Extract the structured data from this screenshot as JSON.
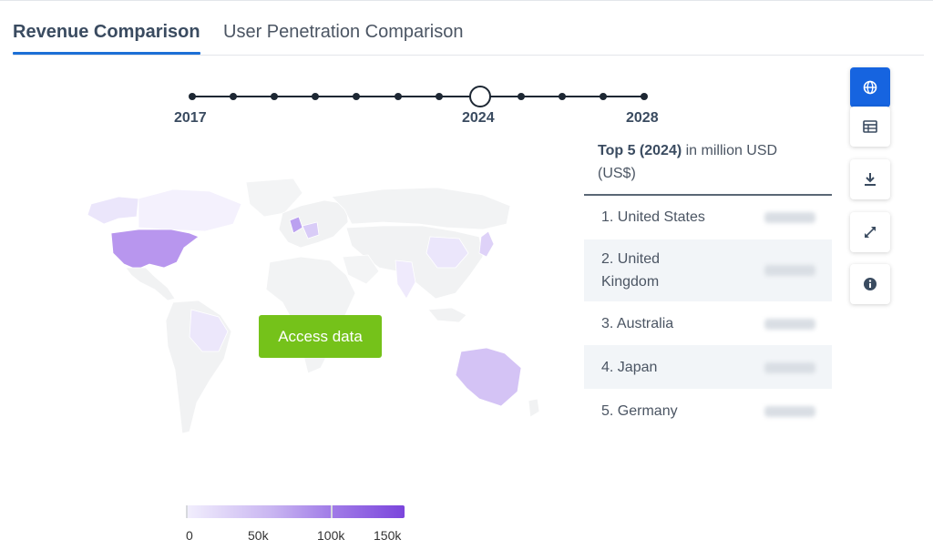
{
  "tabs": [
    {
      "label": "Revenue Comparison",
      "active": true
    },
    {
      "label": "User Penetration Comparison",
      "active": false
    }
  ],
  "timeline": {
    "start_label": "2017",
    "selected_label": "2024",
    "end_label": "2028",
    "selected_year": 2024
  },
  "map": {
    "access_button_label": "Access data"
  },
  "legend": {
    "labels": [
      "0",
      "50k",
      "100k",
      "150k"
    ],
    "color_low": "#f2effd",
    "color_high": "#7b45dc"
  },
  "top5": {
    "title_bold": "Top 5 (2024)",
    "title_rest": " in million USD (US$)",
    "rows": [
      {
        "label": "1. United States"
      },
      {
        "label": "2. United Kingdom"
      },
      {
        "label": "3. Australia"
      },
      {
        "label": "4. Japan"
      },
      {
        "label": "5. Germany"
      }
    ]
  },
  "side_buttons": [
    {
      "icon": "globe-icon",
      "active": true
    },
    {
      "icon": "table-icon",
      "active": false
    },
    {
      "icon": "download-icon",
      "active": false
    },
    {
      "icon": "expand-icon",
      "active": false
    },
    {
      "icon": "info-icon",
      "active": false
    }
  ],
  "colors": {
    "accent": "#1664e0",
    "access_button": "#75c21a",
    "country_high": "#a37fe8",
    "country_low": "#ebe6fb"
  }
}
